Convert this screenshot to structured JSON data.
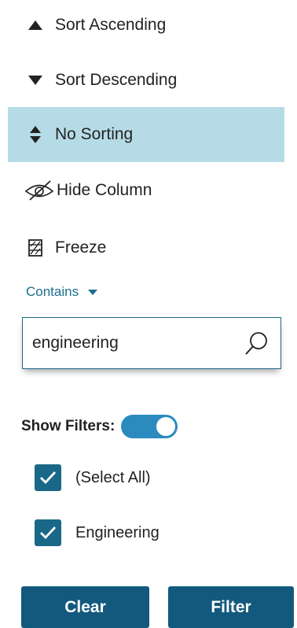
{
  "menu": {
    "sort_asc": "Sort Ascending",
    "sort_desc": "Sort Descending",
    "no_sort": "No Sorting",
    "hide_column": "Hide Column",
    "freeze": "Freeze"
  },
  "filter": {
    "operator": "Contains",
    "search_value": "engineering"
  },
  "show_filters": {
    "label": "Show Filters:",
    "enabled": true
  },
  "checklist": [
    {
      "label": "(Select All)",
      "checked": true
    },
    {
      "label": "Engineering",
      "checked": true
    }
  ],
  "buttons": {
    "clear": "Clear",
    "filter": "Filter"
  },
  "colors": {
    "active_row": "#b5dce6",
    "accent": "#1a6888",
    "button": "#13597d",
    "link": "#1a6e8e"
  },
  "icons": {
    "sort_asc": "triangle-up-icon",
    "sort_desc": "triangle-down-icon",
    "no_sort": "sort-updown-icon",
    "hide": "eye-slash-icon",
    "freeze": "freeze-icon",
    "search": "search-icon",
    "check": "checkmark-icon"
  }
}
